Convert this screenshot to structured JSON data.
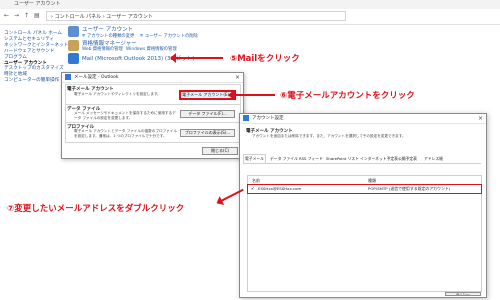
{
  "window": {
    "title": "ユーザー アカウント",
    "breadcrumb": "› コントロール パネル › ユーザー アカウント"
  },
  "sidebar": {
    "items": [
      {
        "label": "コントロール パネル ホーム",
        "current": false
      },
      {
        "label": "システムとセキュリティ",
        "current": false
      },
      {
        "label": "ネットワークとインターネット",
        "current": false
      },
      {
        "label": "ハードウェアとサウンド",
        "current": false
      },
      {
        "label": "プログラム",
        "current": false
      },
      {
        "label": "ユーザー アカウント",
        "current": true
      },
      {
        "label": "デスクトップのカスタマイズ",
        "current": false
      },
      {
        "label": "時計と地域",
        "current": false
      },
      {
        "label": "コンピューターの簡単操作",
        "current": false
      }
    ]
  },
  "panel": {
    "user_accounts": "ユーザー アカウント",
    "ua_link1": "アカウントの種類の変更",
    "ua_link2": "ユーザー アカウントの削除",
    "credential_manager": "資格情報マネージャー",
    "cm_link1": "Web 資格情報の管理",
    "cm_link2": "Windows 資格情報の管理",
    "mail_item": "Mail (Microsoft Outlook 2013) (32 ビット)"
  },
  "annotations": {
    "step5": "⑤Mailをクリック",
    "step6": "⑥電子メールアカウントをクリック",
    "step7": "⑦変更したいメールアドレスをダブルクリック"
  },
  "mail_dialog": {
    "title": "メール設定 - Outlook",
    "email_group": "電子メール アカウント",
    "email_desc": "電子メール アカウントやディレクトリを設定します。",
    "email_button": "電子メール アカウント(E)...",
    "data_group": "データ ファイル",
    "data_desc": "メール メッセージやドキュメントを保存するために使用するデータ ファイルの設定を変更します。",
    "data_button": "データ ファイル(F)...",
    "profile_group": "プロファイル",
    "profile_desc": "電子メール アカウントとデータ ファイルの複数のプロファイルを設定します。通常は、1 つのプロファイルで十分です。",
    "profile_button": "プロファイルの表示(S)...",
    "close_button": "閉じる(C)"
  },
  "account_dialog": {
    "title": "アカウント設定",
    "heading": "電子メール アカウント",
    "subheading": "アカウントを追加または削除できます。また、アカウントを選択してその設定を変更できます。",
    "tabs": [
      "電子メール",
      "データ ファイル",
      "RSS フィード",
      "SharePoint リスト",
      "インターネット予定表",
      "公開予定表",
      "アドレス帳"
    ],
    "col_name": "名前",
    "col_type": "種類",
    "rows": [
      {
        "name": "ESSHxx@ESSHxx.com",
        "type": "POP/SMTP (送信で使用する既定のアカウント)"
      }
    ],
    "close_button": "閉じる(C)"
  },
  "colors": {
    "annotation": "#e0101a",
    "link": "#1e5a9e"
  }
}
